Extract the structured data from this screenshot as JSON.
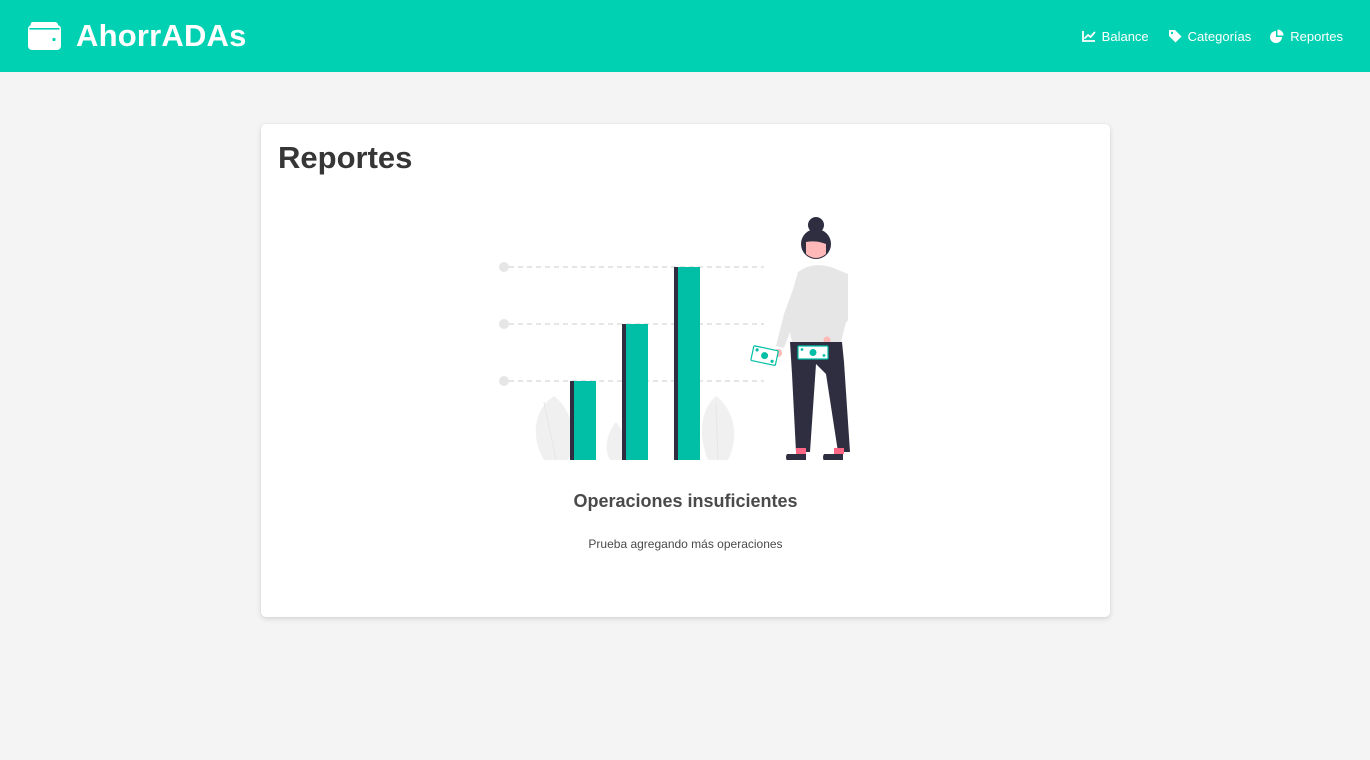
{
  "navbar": {
    "brand": "AhorrADAs",
    "brand_icon": "wallet-icon",
    "items": [
      {
        "label": "Balance",
        "icon": "chart-line-icon"
      },
      {
        "label": "Categorías",
        "icon": "tag-icon"
      },
      {
        "label": "Reportes",
        "icon": "chart-pie-icon"
      }
    ]
  },
  "main": {
    "title": "Reportes",
    "empty_state": {
      "illustration": "woman-with-bar-chart-illustration",
      "title": "Operaciones insuficientes",
      "subtitle": "Prueba agregando más operaciones"
    }
  },
  "colors": {
    "primary": "#00d1b2",
    "background": "#f4f4f4",
    "card": "#ffffff",
    "text": "#363636",
    "dark": "#2f2e41",
    "accent": "#00bfa6"
  }
}
